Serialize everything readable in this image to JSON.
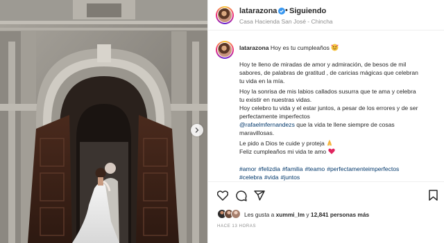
{
  "post": {
    "username": "latarazona",
    "dot": "•",
    "follow_label": "Siguiendo",
    "location": "Casa Hacienda San José - Chincha"
  },
  "caption": {
    "username": "latarazona",
    "first_line": "Hoy es tu cumpleaños",
    "lines": [
      "Hoy te lleno de miradas de amor y admiración, de besos de mil",
      "sabores, de palabras de gratitud , de caricias mágicas que celebran",
      "tu vida en la mía.",
      "Hoy la sonrisa de mis labios callados susurra que te ama y celebra",
      "tu existir en nuestras vidas.",
      "Hoy celebro tu vida y el estar juntos, a pesar de los errores y de ser",
      "perfectamente imperfectos"
    ],
    "mention": "@rafaelmfernandezs",
    "mention_rest": " que la vida te llene siempre de cosas",
    "line_after_mention": "maravillosas.",
    "line_prayer": "Le pido a Dios te cuide y proteja",
    "line_final": "Feliz cumpleaños mi vida te amo",
    "hashtags_row1": [
      "#amor",
      "#felizdia",
      "#familia",
      "#teamo",
      "#perfectamenteimperfectos"
    ],
    "hashtags_row2": [
      "#celebra",
      "#vida",
      "#juntos"
    ]
  },
  "likes": {
    "prefix": "Les gusta a",
    "user": "xummi_lm",
    "middle": "y",
    "count": "12,841 personas más"
  },
  "time_ago": "HACE 13 HORAS",
  "icons": [
    "verified-badge-icon",
    "emoji-face-icon",
    "praying-hands-icon",
    "red-heart-icon",
    "next-arrow-icon",
    "like-heart-icon",
    "comment-icon",
    "share-icon",
    "bookmark-icon"
  ],
  "colors": {
    "link": "#00376b",
    "verified": "#3897f0",
    "heart": "#ed4956",
    "muted": "#8e8e8e"
  }
}
